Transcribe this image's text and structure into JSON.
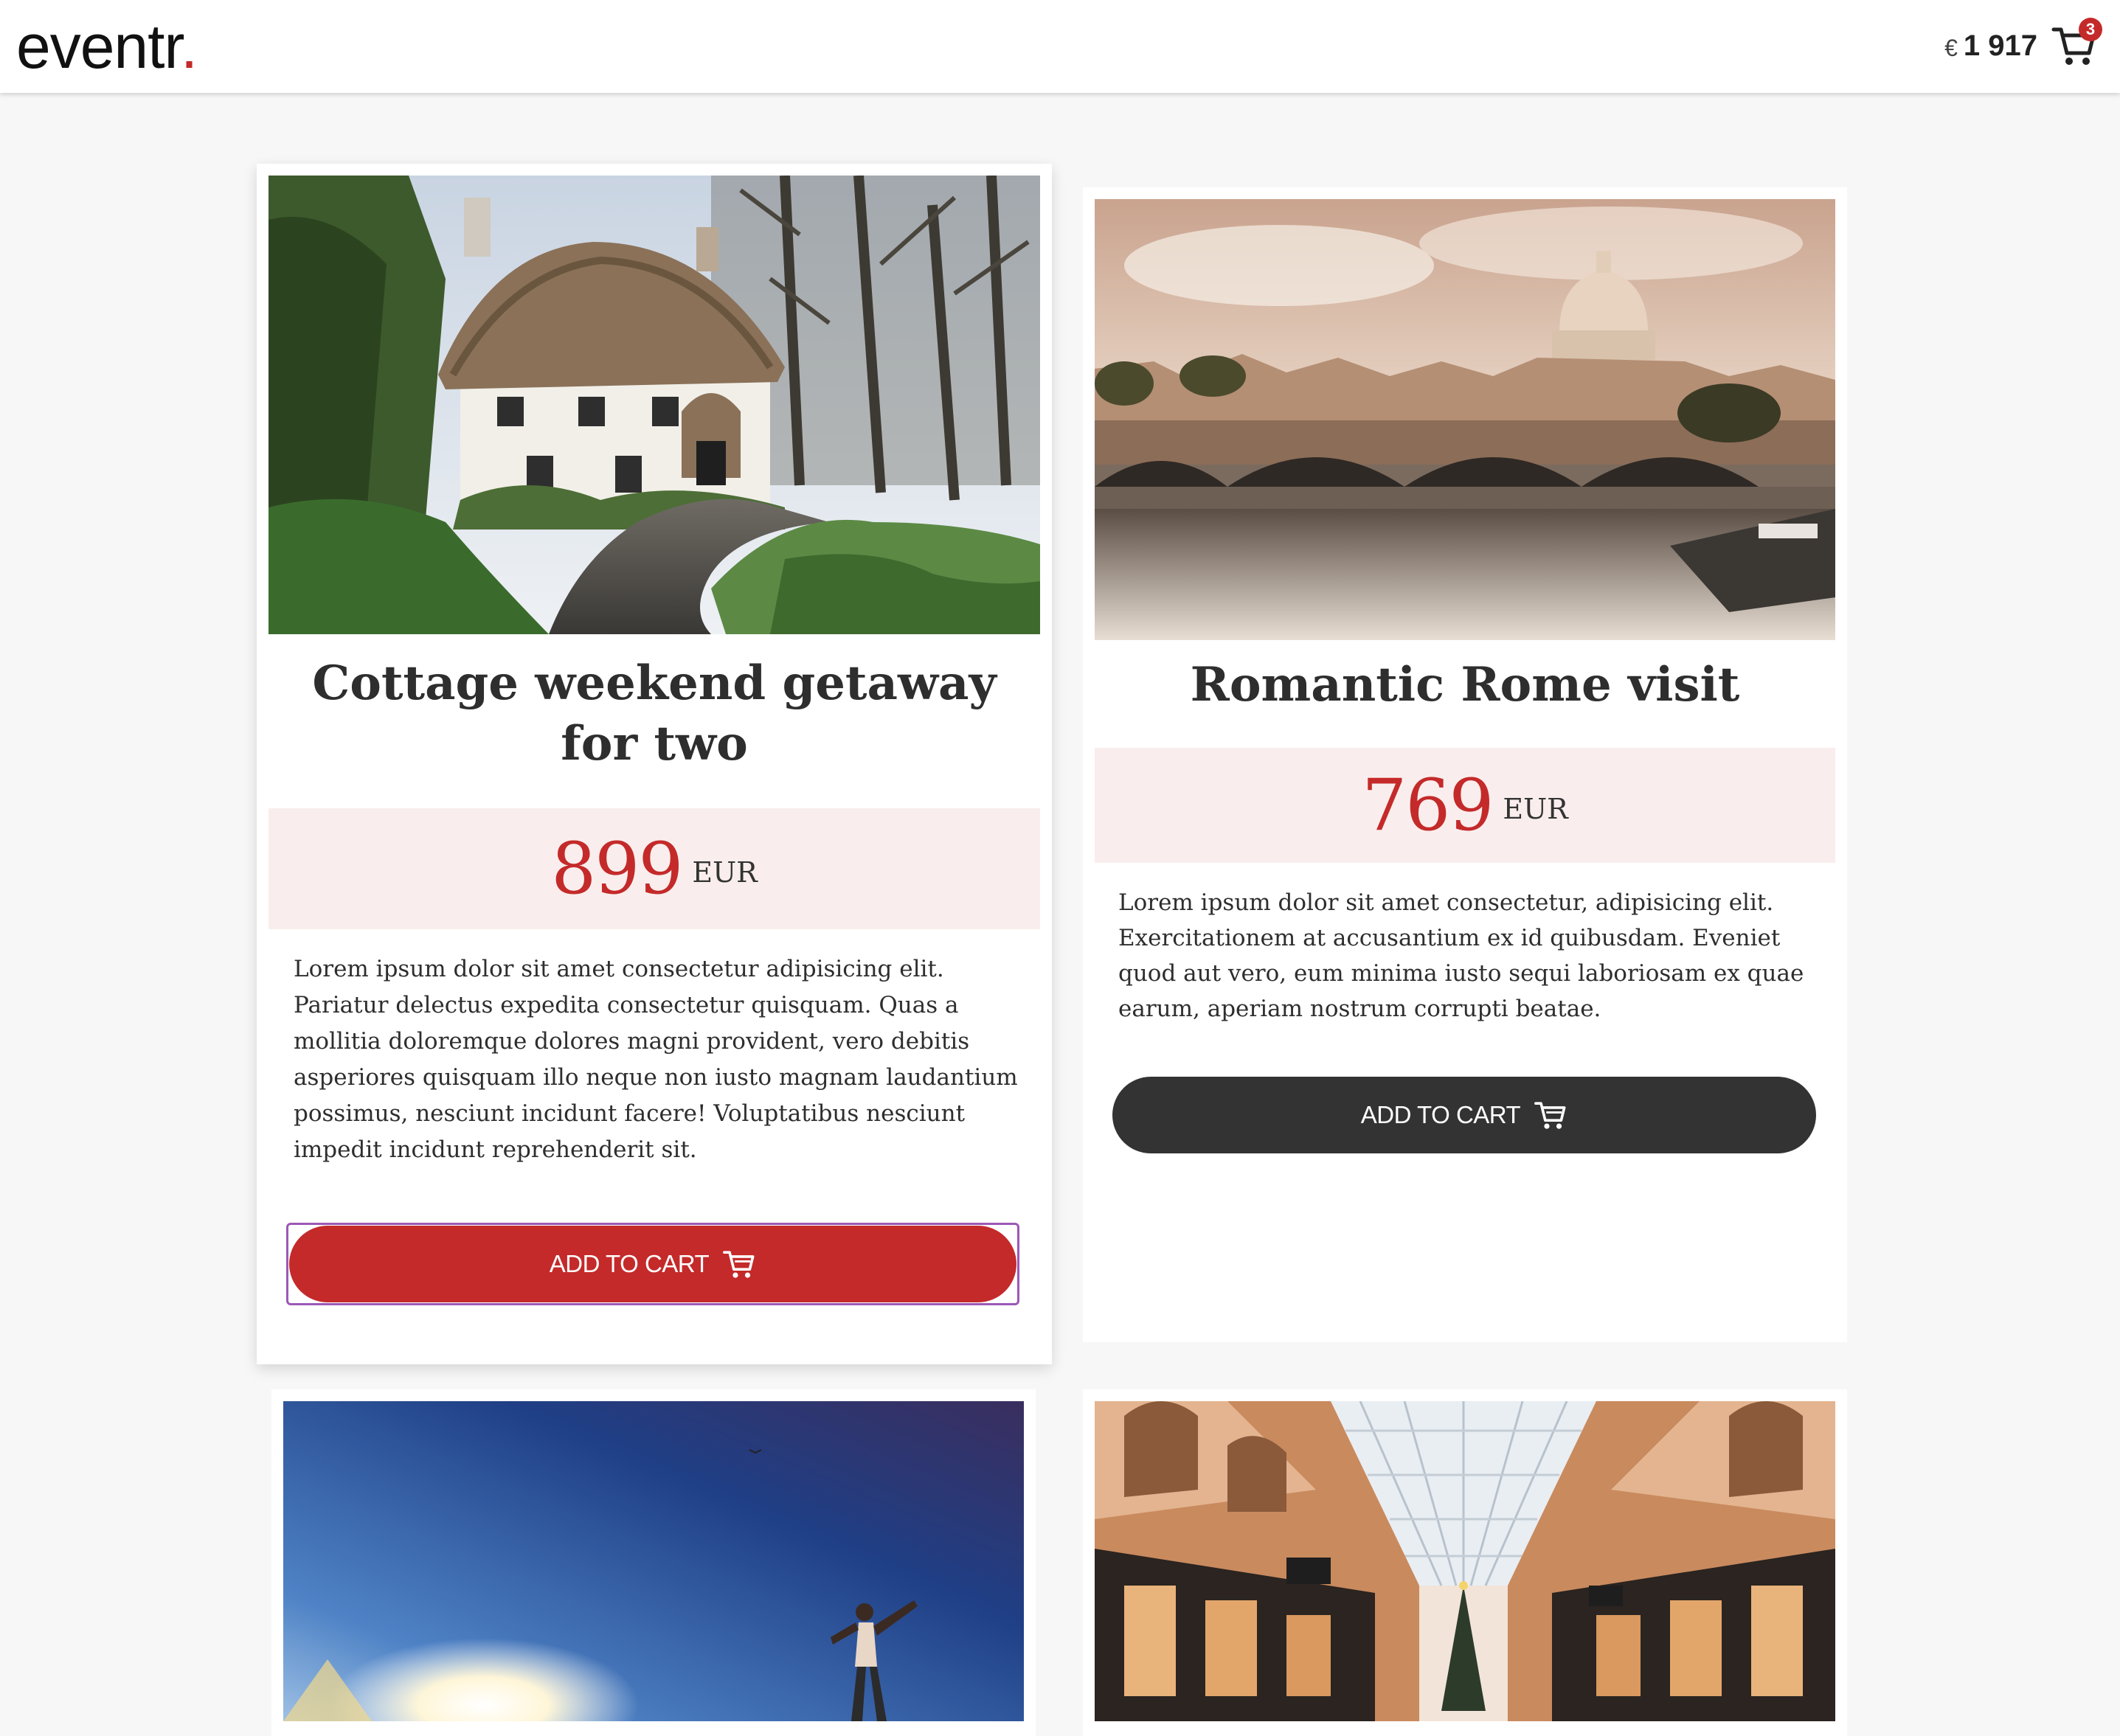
{
  "header": {
    "logo_text": "eventr",
    "logo_dot": ".",
    "currency_symbol": "€",
    "cart_total": "1 917",
    "cart_count": "3",
    "cart_icon": "cart-icon"
  },
  "products": [
    {
      "title": "Cottage weekend getaway for two",
      "price": "899",
      "currency": "EUR",
      "description": "Lorem ipsum dolor sit amet consectetur adipisicing elit. Pariatur delectus expedita consectetur quisquam. Quas a mollitia doloremque dolores magni provident, vero debitis asperiores quisquam illo neque non iusto magnam laudantium possimus, nesciunt incidunt facere! Voluptatibus nesciunt impedit incidunt reprehenderit sit.",
      "button_label": "ADD TO CART",
      "button_color": "#c42a2a"
    },
    {
      "title": "Romantic Rome visit",
      "price": "769",
      "currency": "EUR",
      "description": "Lorem ipsum dolor sit amet consectetur, adipisicing elit. Exercitationem at accusantium ex id quibusdam. Eveniet quod aut vero, eum minima iusto sequi laboriosam ex quae earum, aperiam nostrum corrupti beatae.",
      "button_label": "ADD TO CART",
      "button_color": "#333333"
    }
  ],
  "colors": {
    "accent": "#c42a2a",
    "price_band": "#f9eeed",
    "dark_button": "#333333",
    "page_bg": "#f7f7f7"
  }
}
